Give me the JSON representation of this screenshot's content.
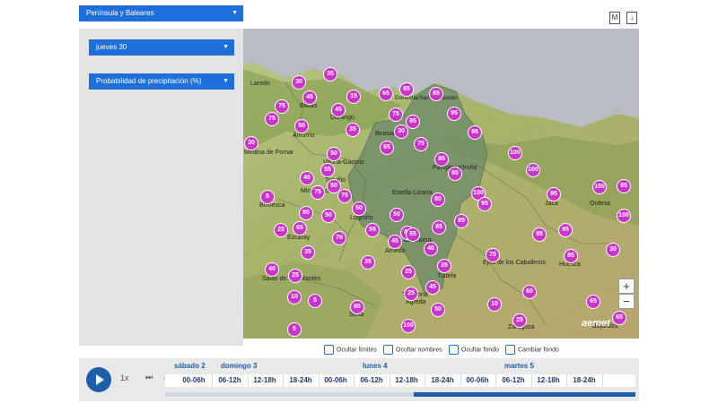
{
  "panel": {
    "region": "Península y Baleares",
    "day": "jueves 30",
    "variable": "Probabilidad de precipitación (%)"
  },
  "toolbar": {
    "icon_m": "M",
    "icon_download": "↓"
  },
  "map": {
    "brand": "aemet",
    "places": [
      "Laredo",
      "Bilbao",
      "Durango",
      "Donostia/San Sebastián",
      "Amurrio",
      "Beasain",
      "Medina de Pomar",
      "Vitoria-Gasteiz",
      "Treviño",
      "Miranda de Ebro",
      "Pamplona/Iruña",
      "Briviesca",
      "Estella-Lizarra",
      "Logroño",
      "Jaca",
      "Ezcaray",
      "Arnedo",
      "Calahorra",
      "Tudela",
      "Huesca",
      "Ejea de los Caballeros",
      "Salas de los Infantes",
      "Tarazona",
      "Agreda",
      "Soria",
      "Zaragoza",
      "Bujaraloz",
      "Ordesa"
    ],
    "values": [
      35,
      30,
      45,
      15,
      65,
      85,
      85,
      75,
      75,
      45,
      75,
      85,
      95,
      50,
      35,
      30,
      65,
      75,
      95,
      30,
      50,
      80,
      100,
      100,
      55,
      40,
      80,
      100,
      50,
      75,
      75,
      50,
      95,
      95,
      95,
      5,
      80,
      80,
      100,
      50,
      50,
      85,
      100,
      20,
      65,
      55,
      70,
      80,
      85,
      95,
      85,
      35,
      45,
      55,
      35,
      70,
      40,
      85,
      30,
      25,
      40,
      25,
      45,
      35,
      10,
      50,
      25,
      10,
      65,
      5,
      5,
      25,
      60,
      65,
      80,
      100
    ]
  },
  "controls": {
    "zoom_in": "+",
    "zoom_out": "−",
    "hide_limits": "Ocultar límites",
    "hide_names": "Ocultar nombres",
    "hide_background": "Ocultar fondo",
    "change_background": "Cambiar fondo"
  },
  "timeline": {
    "speed": "1x",
    "fast_forward": "⏭",
    "days": [
      "sábado 2",
      "domingo 3",
      "lunes 4",
      "martes 5"
    ],
    "slots": [
      "00-06h",
      "06-12h",
      "12-18h",
      "18-24h",
      "00-06h",
      "06-12h",
      "12-18h",
      "18-24h",
      "00-06h",
      "06-12h",
      "12-18h",
      "18-24h"
    ]
  }
}
